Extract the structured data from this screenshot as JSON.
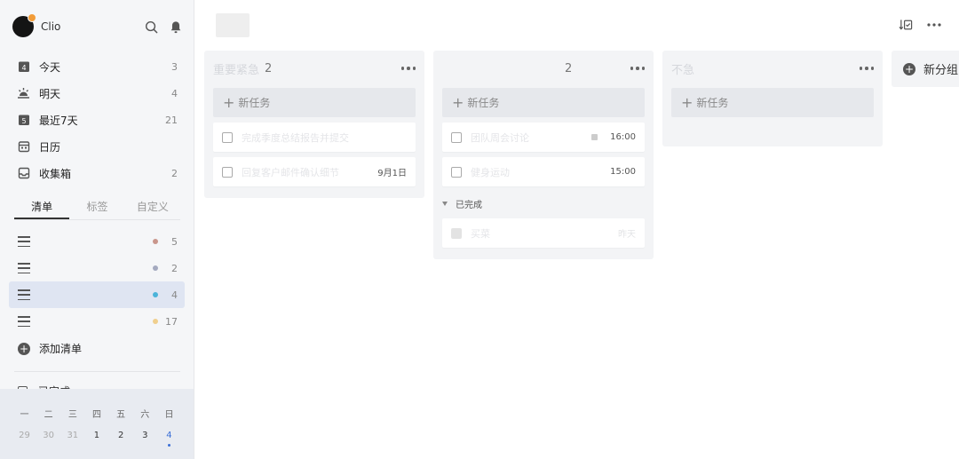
{
  "user": {
    "name": "Clio"
  },
  "smart_lists": [
    {
      "label": "今天",
      "count": "3",
      "icon": "calendar-today-icon"
    },
    {
      "label": "明天",
      "count": "4",
      "icon": "sunrise-icon"
    },
    {
      "label": "最近7天",
      "count": "21",
      "icon": "calendar-week-icon"
    },
    {
      "label": "日历",
      "count": "",
      "icon": "calendar-icon"
    },
    {
      "label": "收集箱",
      "count": "2",
      "icon": "inbox-icon"
    }
  ],
  "tabs": [
    "清单",
    "标签",
    "自定义"
  ],
  "lists": [
    {
      "count": "5",
      "color": "#c9968c"
    },
    {
      "count": "2",
      "color": "#a4a9bf"
    },
    {
      "count": "4",
      "color": "#4bb3d9"
    },
    {
      "count": "17",
      "color": "#f0cf8e"
    }
  ],
  "add_list_label": "添加清单",
  "completed_label": "已完成",
  "calendar": {
    "weekdays": [
      "一",
      "二",
      "三",
      "四",
      "五",
      "六",
      "日"
    ],
    "dates": [
      "29",
      "30",
      "31",
      "1",
      "2",
      "3",
      "4"
    ]
  },
  "columns": [
    {
      "title": "重要紧急",
      "count": "2",
      "new_task": "新任务",
      "tasks": [
        {
          "title": "完成季度总结报告并提交",
          "meta": ""
        },
        {
          "title": "回复客户邮件确认细节",
          "meta": "9月1日"
        }
      ]
    },
    {
      "title": "",
      "count": "2",
      "new_task": "新任务",
      "tasks": [
        {
          "title": "团队周会讨论",
          "meta": "16:00"
        },
        {
          "title": "健身运动",
          "meta": "15:00"
        }
      ],
      "done_label": "已完成",
      "done_tasks": [
        {
          "title": "买菜",
          "meta": "昨天"
        }
      ]
    },
    {
      "title": "不急",
      "count": "",
      "new_task": "新任务",
      "tasks": []
    }
  ],
  "add_section_label": "新分组"
}
